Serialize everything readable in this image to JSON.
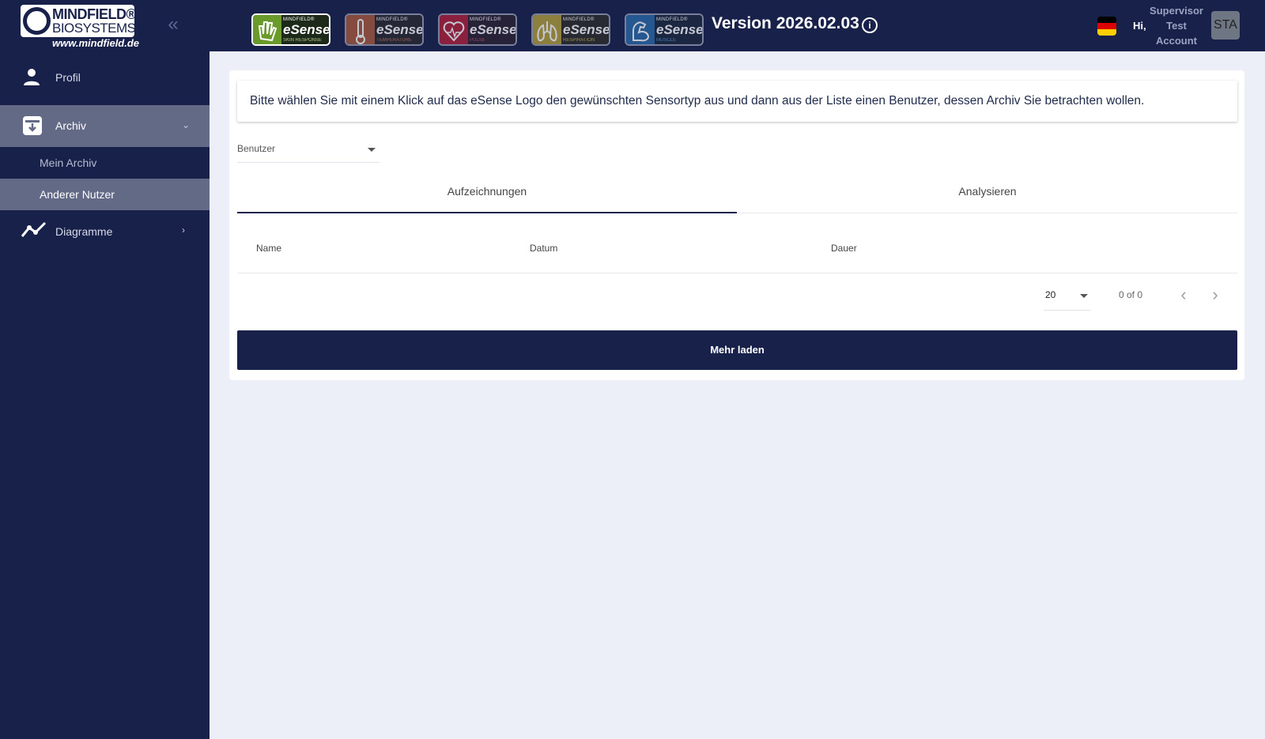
{
  "header": {
    "logo_line1": "MINDFIELD®",
    "logo_line2": "BIOSYSTEMS",
    "logo_url": "www.mindfield.de",
    "collapse_icon": "double-chevron-left-icon",
    "sensors": [
      {
        "brand": "MINDFIELD®",
        "name": "eSense",
        "sub": "SKIN RESPONSE",
        "color": "#6a9a2c",
        "active": true,
        "icon": "hand-icon"
      },
      {
        "brand": "MINDFIELD®",
        "name": "eSense",
        "sub": "TEMPERATURE",
        "color": "#a85a3a",
        "active": false,
        "icon": "thermometer-icon"
      },
      {
        "brand": "MINDFIELD®",
        "name": "eSense",
        "sub": "PULSE",
        "color": "#b0203a",
        "active": false,
        "icon": "heart-pulse-icon"
      },
      {
        "brand": "MINDFIELD®",
        "name": "eSense",
        "sub": "RESPIRATION",
        "color": "#b5a03a",
        "active": false,
        "icon": "lungs-icon"
      },
      {
        "brand": "MINDFIELD®",
        "name": "eSense",
        "sub": "MUSCLE",
        "color": "#2a6aa8",
        "active": false,
        "icon": "arm-muscle-icon"
      }
    ],
    "version": "Version 2026.02.03",
    "hi": "Hi,",
    "user_line1": "Supervisor",
    "user_line2": "Test",
    "user_line3": "Account",
    "avatar": "STA",
    "flag_colors": [
      "#000000",
      "#dd0000",
      "#ffce00"
    ]
  },
  "sidebar": {
    "profile": "Profil",
    "archive": "Archiv",
    "my_archive": "Mein Archiv",
    "other_user": "Anderer Nutzer",
    "charts": "Diagramme",
    "active_color": "#636a86"
  },
  "main": {
    "instruction": "Bitte wählen Sie mit einem Klick auf das eSense Logo den gewünschten Sensortyp aus und dann aus der Liste einen Benutzer, dessen Archiv Sie betrachten wollen.",
    "user_select_placeholder": "Benutzer",
    "tabs": [
      {
        "label": "Aufzeichnungen",
        "active": true
      },
      {
        "label": "Analysieren",
        "active": false
      }
    ],
    "columns": [
      "Name",
      "Datum",
      "Dauer"
    ],
    "rows": [],
    "page_size": "20",
    "range": "0 of 0",
    "load_more": "Mehr laden"
  }
}
